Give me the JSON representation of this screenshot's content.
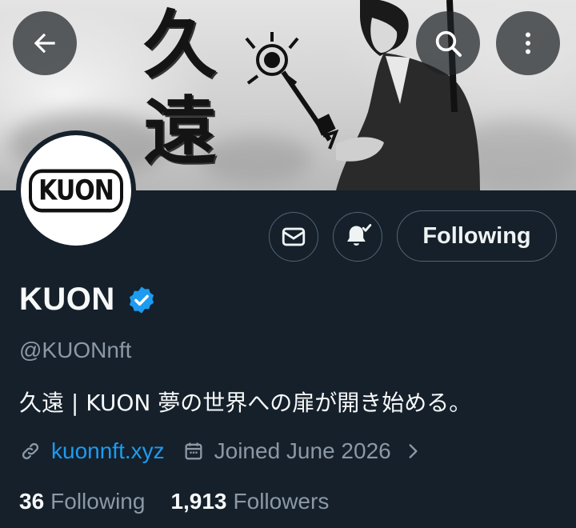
{
  "profile": {
    "name": "KUON",
    "handle": "@KUONnft",
    "bio": "久遠 | KUON 夢の世界への扉が開き始める。",
    "website": "kuonnft.xyz",
    "joined": "Joined June 2026",
    "avatar_text": "KUON",
    "verified": true
  },
  "banner": {
    "calligraphy": [
      "久",
      "遠"
    ]
  },
  "header": {
    "back_icon": "arrow-left-icon",
    "search_icon": "search-icon",
    "more_icon": "more-vertical-icon"
  },
  "actions": {
    "message_icon": "mail-icon",
    "notify_icon": "bell-check-icon",
    "follow_label": "Following"
  },
  "stats": {
    "following_count": "36",
    "following_label": "Following",
    "followers_count": "1,913",
    "followers_label": "Followers"
  },
  "colors": {
    "background": "#15202b",
    "text_primary": "#f7f9f9",
    "text_secondary": "#8b98a5",
    "link": "#1d9bf0",
    "verified_badge": "#1d9bf0",
    "button_border": "#536471"
  }
}
